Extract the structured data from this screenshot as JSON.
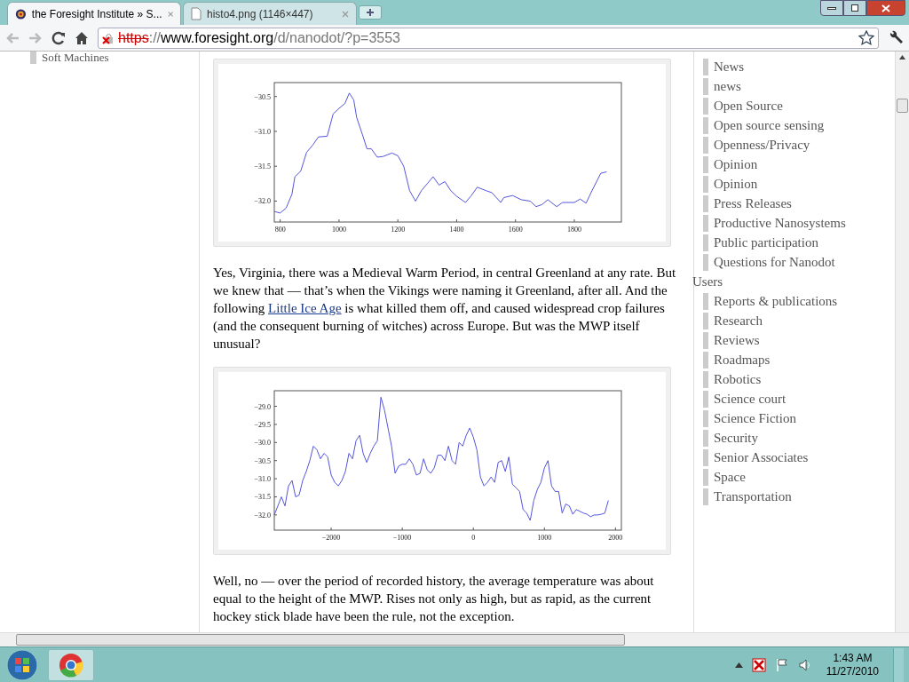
{
  "tabs": [
    {
      "title": "the Foresight Institute » S...",
      "kind": "site",
      "selected": true
    },
    {
      "title": "histo4.png (1146×447)",
      "kind": "file",
      "selected": false
    }
  ],
  "address": {
    "scheme": "https",
    "separator": "://",
    "host": "www.foresight.org",
    "path": "/d/nanodot/?p=3553",
    "insecure": true
  },
  "left_sidebar": {
    "items": [
      "Soft Machines"
    ]
  },
  "content": [
    {
      "kind": "figure",
      "chart_data": {
        "type": "line",
        "xlim": [
          780,
          1960
        ],
        "ylim": [
          -32.3,
          -30.3
        ],
        "xticks": [
          800,
          1000,
          1200,
          1400,
          1600,
          1800
        ],
        "yticks": [
          {
            "value": -32.0,
            "label": "−32.0"
          },
          {
            "value": -31.5,
            "label": "−31.5"
          },
          {
            "value": -31.0,
            "label": "−31.0"
          },
          {
            "value": -30.5,
            "label": "−30.5"
          }
        ],
        "x": [
          780,
          800,
          820,
          840,
          850,
          870,
          890,
          910,
          930,
          960,
          980,
          1000,
          1020,
          1035,
          1050,
          1060,
          1080,
          1095,
          1110,
          1130,
          1150,
          1180,
          1200,
          1220,
          1240,
          1260,
          1280,
          1300,
          1320,
          1340,
          1360,
          1380,
          1400,
          1430,
          1450,
          1470,
          1500,
          1520,
          1550,
          1560,
          1590,
          1620,
          1650,
          1670,
          1690,
          1710,
          1740,
          1760,
          1800,
          1820,
          1840,
          1860,
          1890,
          1910
        ],
        "series": [
          {
            "color": "#5555dd",
            "values": [
              -32.15,
              -32.17,
              -32.1,
              -31.9,
              -31.65,
              -31.57,
              -31.3,
              -31.2,
              -31.08,
              -31.07,
              -30.75,
              -30.67,
              -30.6,
              -30.45,
              -30.55,
              -30.8,
              -31.05,
              -31.25,
              -31.25,
              -31.37,
              -31.36,
              -31.31,
              -31.35,
              -31.5,
              -31.85,
              -32.0,
              -31.85,
              -31.75,
              -31.65,
              -31.77,
              -31.72,
              -31.85,
              -31.93,
              -32.02,
              -31.92,
              -31.8,
              -31.85,
              -31.88,
              -32.02,
              -31.95,
              -31.92,
              -31.98,
              -32.0,
              -32.08,
              -32.05,
              -31.98,
              -32.08,
              -32.02,
              -32.02,
              -31.97,
              -32.03,
              -31.85,
              -31.6,
              -31.58
            ]
          }
        ]
      }
    },
    {
      "kind": "paragraph",
      "parts": [
        {
          "kind": "text",
          "text": "Yes, Virginia, there was a Medieval Warm Period, in central Greenland at any rate.  But we knew that — that’s when the Vikings were naming it Greenland, after all.  And the following "
        },
        {
          "kind": "link",
          "text": "Little Ice Age"
        },
        {
          "kind": "text",
          "text": " is what killed them off, and caused widespread crop failures (and the consequent burning of witches) across Europe.  But was the MWP itself unusual?"
        }
      ]
    },
    {
      "kind": "figure",
      "chart_data": {
        "type": "line",
        "xlim": [
          -2800,
          2083
        ],
        "ylim": [
          -32.42,
          -28.57
        ],
        "xticks": [
          {
            "value": -2000,
            "label": "−2000"
          },
          {
            "value": -1000,
            "label": "−1000"
          },
          0,
          1000,
          2000
        ],
        "yticks": [
          {
            "value": -32.0,
            "label": "−32.0"
          },
          {
            "value": -31.5,
            "label": "−31.5"
          },
          {
            "value": -31.0,
            "label": "−31.0"
          },
          {
            "value": -30.5,
            "label": "−30.5"
          },
          {
            "value": -30.0,
            "label": "−30.0"
          },
          {
            "value": -29.5,
            "label": "−29.5"
          },
          {
            "value": -29.0,
            "label": "−29.0"
          }
        ],
        "x": [
          -2800,
          -2700,
          -2650,
          -2600,
          -2550,
          -2500,
          -2450,
          -2400,
          -2350,
          -2300,
          -2250,
          -2200,
          -2150,
          -2100,
          -2050,
          -2000,
          -1950,
          -1900,
          -1850,
          -1800,
          -1750,
          -1700,
          -1650,
          -1600,
          -1550,
          -1500,
          -1450,
          -1400,
          -1350,
          -1300,
          -1250,
          -1200,
          -1150,
          -1100,
          -1050,
          -1000,
          -950,
          -900,
          -850,
          -800,
          -750,
          -700,
          -650,
          -600,
          -550,
          -500,
          -450,
          -400,
          -350,
          -300,
          -250,
          -200,
          -150,
          -100,
          -50,
          0,
          50,
          100,
          150,
          200,
          250,
          300,
          350,
          400,
          450,
          500,
          550,
          600,
          650,
          700,
          750,
          800,
          850,
          900,
          950,
          1000,
          1050,
          1100,
          1150,
          1200,
          1250,
          1300,
          1350,
          1400,
          1450,
          1500,
          1550,
          1600,
          1650,
          1700,
          1750,
          1800,
          1850,
          1900
        ],
        "series": [
          {
            "color": "#5555dd",
            "values": [
              -32.0,
              -31.5,
              -31.75,
              -31.2,
              -31.05,
              -31.5,
              -31.45,
              -31.05,
              -30.8,
              -30.5,
              -30.1,
              -30.2,
              -30.45,
              -30.3,
              -30.4,
              -30.9,
              -31.1,
              -31.2,
              -31.05,
              -30.8,
              -30.3,
              -30.45,
              -29.95,
              -29.8,
              -30.3,
              -30.55,
              -30.3,
              -30.1,
              -29.95,
              -28.75,
              -29.1,
              -29.6,
              -30.1,
              -30.85,
              -30.65,
              -30.6,
              -30.6,
              -30.45,
              -30.6,
              -30.9,
              -30.85,
              -30.45,
              -30.75,
              -30.85,
              -30.7,
              -30.35,
              -30.35,
              -30.5,
              -30.1,
              -30.5,
              -30.6,
              -30.0,
              -30.1,
              -29.8,
              -29.6,
              -29.85,
              -30.2,
              -30.95,
              -31.2,
              -31.1,
              -30.95,
              -31.1,
              -30.55,
              -30.5,
              -30.8,
              -30.4,
              -31.15,
              -31.25,
              -31.35,
              -31.85,
              -31.95,
              -32.15,
              -31.6,
              -31.3,
              -31.1,
              -30.7,
              -30.5,
              -31.2,
              -31.35,
              -31.35,
              -31.95,
              -31.7,
              -31.75,
              -31.98,
              -31.85,
              -31.9,
              -31.95,
              -31.98,
              -32.05,
              -32.0,
              -32.0,
              -31.98,
              -31.95,
              -31.6
            ]
          }
        ]
      }
    },
    {
      "kind": "paragraph",
      "parts": [
        {
          "kind": "text",
          "text": "Well, no — over the period of recorded history, the average temperature was about equal to the height of the MWP.  Rises not only as high, but as rapid, as the current hockey stick blade have been the rule, not the exception."
        }
      ]
    }
  ],
  "right_sidebar": {
    "items": [
      {
        "label": "News",
        "kind": "sub"
      },
      {
        "label": "news",
        "kind": "sub"
      },
      {
        "label": "Open Source",
        "kind": "sub"
      },
      {
        "label": "Open source sensing",
        "kind": "sub"
      },
      {
        "label": "Openness/Privacy",
        "kind": "sub"
      },
      {
        "label": "Opinion",
        "kind": "sub"
      },
      {
        "label": "Opinion",
        "kind": "sub"
      },
      {
        "label": "Press Releases",
        "kind": "sub"
      },
      {
        "label": "Productive Nanosystems",
        "kind": "sub"
      },
      {
        "label": "Public participation",
        "kind": "sub"
      },
      {
        "label": "Questions for Nanodot",
        "kind": "sub"
      },
      {
        "label": "Users",
        "kind": "top"
      },
      {
        "label": "Reports & publications",
        "kind": "sub"
      },
      {
        "label": "Research",
        "kind": "sub"
      },
      {
        "label": "Reviews",
        "kind": "sub"
      },
      {
        "label": "Roadmaps",
        "kind": "sub"
      },
      {
        "label": "Robotics",
        "kind": "sub"
      },
      {
        "label": "Science court",
        "kind": "sub"
      },
      {
        "label": "Science Fiction",
        "kind": "sub"
      },
      {
        "label": "Security",
        "kind": "sub"
      },
      {
        "label": "Senior Associates",
        "kind": "sub"
      },
      {
        "label": "Space",
        "kind": "sub"
      },
      {
        "label": "Transportation",
        "kind": "sub"
      }
    ]
  },
  "taskbar": {
    "time": "1:43 AM",
    "date": "11/27/2010"
  }
}
